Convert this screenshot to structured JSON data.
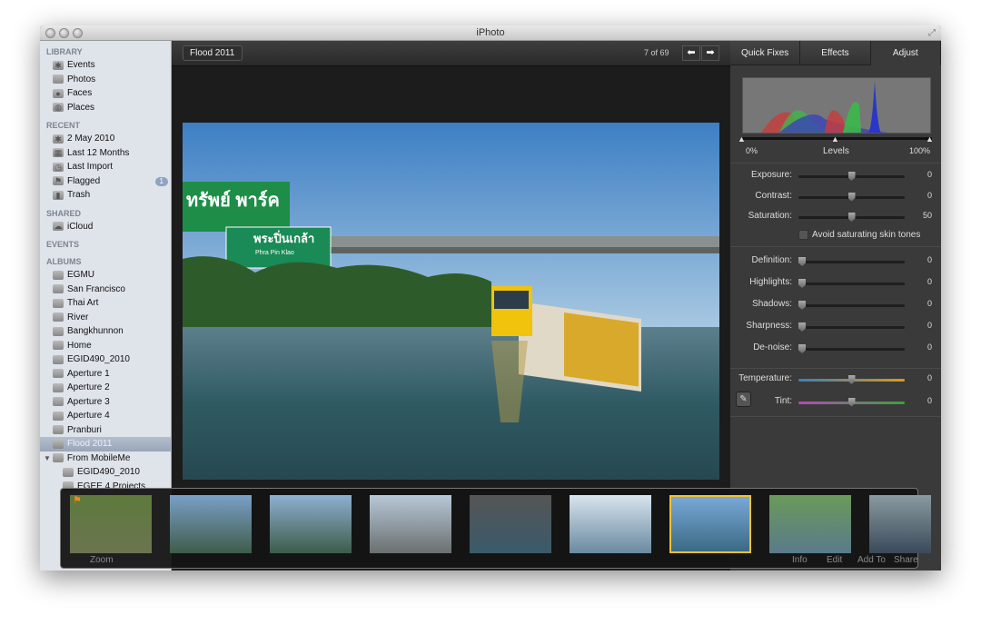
{
  "window": {
    "title": "iPhoto"
  },
  "sidebar": {
    "sections": [
      {
        "title": "LIBRARY",
        "items": [
          {
            "label": "Events",
            "icon": "palm-icon"
          },
          {
            "label": "Photos",
            "icon": "photos-icon"
          },
          {
            "label": "Faces",
            "icon": "person-icon"
          },
          {
            "label": "Places",
            "icon": "globe-icon"
          }
        ]
      },
      {
        "title": "RECENT",
        "items": [
          {
            "label": "2 May 2010",
            "icon": "palm-icon"
          },
          {
            "label": "Last 12 Months",
            "icon": "calendar-icon"
          },
          {
            "label": "Last Import",
            "icon": "clock-icon"
          },
          {
            "label": "Flagged",
            "icon": "flag-icon",
            "badge": "1"
          },
          {
            "label": "Trash",
            "icon": "trash-icon"
          }
        ]
      },
      {
        "title": "SHARED",
        "items": [
          {
            "label": "iCloud",
            "icon": "cloud-icon"
          }
        ]
      },
      {
        "title": "EVENTS",
        "items": []
      },
      {
        "title": "ALBUMS",
        "items": [
          {
            "label": "EGMU"
          },
          {
            "label": "San Francisco"
          },
          {
            "label": "Thai Art"
          },
          {
            "label": "River"
          },
          {
            "label": "Bangkhunnon"
          },
          {
            "label": "Home"
          },
          {
            "label": "EGID490_2010"
          },
          {
            "label": "Aperture 1"
          },
          {
            "label": "Aperture 2"
          },
          {
            "label": "Aperture 3"
          },
          {
            "label": "Aperture 4"
          },
          {
            "label": "Pranburi"
          },
          {
            "label": "Flood 2011",
            "selected": true
          },
          {
            "label": "From MobileMe",
            "folder": true
          },
          {
            "label": "EGID490_2010",
            "indent": true
          },
          {
            "label": "EGEE 4 Projects",
            "indent": true
          }
        ]
      }
    ]
  },
  "viewer": {
    "breadcrumb": "Flood 2011",
    "counter": "7 of 69",
    "sign_text_1": "ทรัพย์ พาร์ค",
    "sign_text_2": "พระปิ่นเกล้า",
    "sign_text_3": "Phra Pin Klao"
  },
  "panel": {
    "tabs": [
      "Quick Fixes",
      "Effects",
      "Adjust"
    ],
    "active_tab": "Adjust",
    "levels": {
      "label": "Levels",
      "min": "0%",
      "max": "100%"
    },
    "sliders1": [
      {
        "label": "Exposure:",
        "value": "0",
        "pos": 0.5
      },
      {
        "label": "Contrast:",
        "value": "0",
        "pos": 0.5
      },
      {
        "label": "Saturation:",
        "value": "50",
        "pos": 0.5
      }
    ],
    "checkbox": {
      "label": "Avoid saturating skin tones",
      "checked": false
    },
    "sliders2": [
      {
        "label": "Definition:",
        "value": "0",
        "pos": 0
      },
      {
        "label": "Highlights:",
        "value": "0",
        "pos": 0
      },
      {
        "label": "Shadows:",
        "value": "0",
        "pos": 0
      },
      {
        "label": "Sharpness:",
        "value": "0",
        "pos": 0
      },
      {
        "label": "De-noise:",
        "value": "0",
        "pos": 0
      }
    ],
    "sliders3": [
      {
        "label": "Temperature:",
        "value": "0",
        "pos": 0.5
      },
      {
        "label": "Tint:",
        "value": "0",
        "pos": 0.5
      }
    ]
  },
  "filmstrip": {
    "selected_index": 6,
    "count": 9,
    "accent": "#f2c230"
  },
  "toolbar": {
    "zoom": "Zoom",
    "info": "Info",
    "edit": "Edit",
    "add_to": "Add To",
    "share": "Share"
  }
}
